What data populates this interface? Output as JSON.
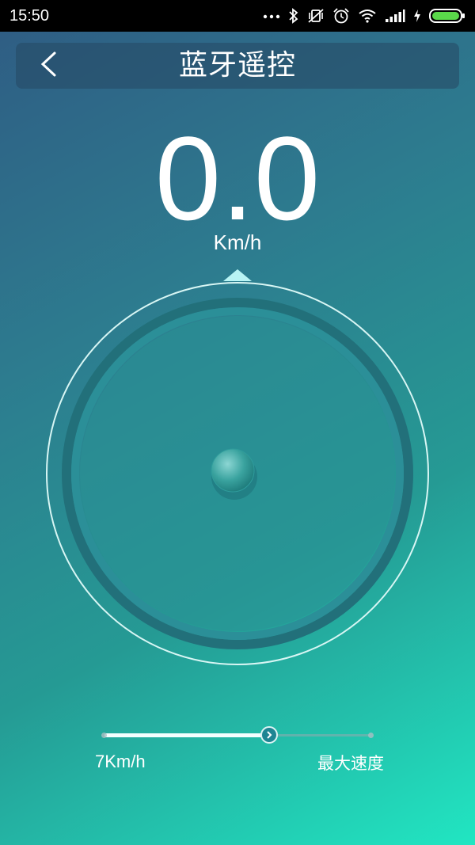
{
  "status_bar": {
    "time": "15:50",
    "icons": [
      "more-dots-icon",
      "bluetooth-icon",
      "vibrate-off-icon",
      "alarm-icon",
      "wifi-icon",
      "signal-icon",
      "charging-icon",
      "battery-icon"
    ]
  },
  "header": {
    "title": "蓝牙遥控",
    "back_icon": "chevron-left-icon"
  },
  "speed": {
    "value": "0.0",
    "unit": "Km/h"
  },
  "joystick": {
    "indicator_icon": "triangle-up-icon"
  },
  "speed_slider": {
    "min_label": "7Km/h",
    "max_label": "最大速度",
    "fraction": 0.62,
    "thumb_icon": "chevron-right-icon"
  },
  "colors": {
    "status_bar": "#000000",
    "gradient_start": "#2f5b83",
    "gradient_end": "#21e6c2",
    "accent": "#b8f4f4"
  }
}
